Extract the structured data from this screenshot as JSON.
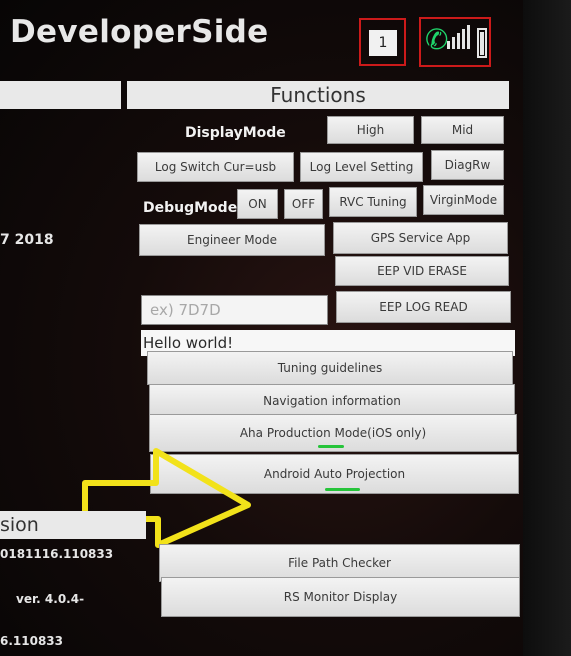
{
  "header": {
    "title": "DeveloperSide",
    "notification_count": "1"
  },
  "tabs": {
    "functions": "Functions"
  },
  "labels": {
    "display_mode": "DisplayMode",
    "debug_mode": "DebugMode"
  },
  "buttons": {
    "high": "High",
    "mid": "Mid",
    "log_switch": "Log Switch Cur=usb",
    "log_level": "Log Level Setting",
    "diag_rw": "DiagRw",
    "on": "ON",
    "off": "OFF",
    "rvc_tuning": "RVC Tuning",
    "virgin_mode": "VirginMode",
    "engineer_mode": "Engineer Mode",
    "gps_service": "GPS Service App",
    "eep_vid_erase": "EEP VID ERASE",
    "eep_log_read": "EEP LOG READ",
    "tuning_guidelines": "Tuning guidelines",
    "navigation_info": "Navigation information",
    "aha_mode": "Aha Production Mode(iOS only)",
    "android_auto": "Android Auto Projection",
    "file_path_checker": "File Path Checker",
    "rs_monitor": "RS Monitor Display"
  },
  "input": {
    "placeholder": "ex) 7D7D"
  },
  "text": {
    "hello": "Hello world!"
  },
  "left_info": {
    "year": "7 2018",
    "version_header": "sion",
    "build": "0181116.110833",
    "version": "ver. 4.0.4-",
    "build2": "6.110833"
  },
  "colors": {
    "status_frame": "#cc1a1a",
    "phone_icon": "#1fd46a",
    "highlight_arrow": "#f2e21a",
    "active_underline": "#26c43a"
  }
}
